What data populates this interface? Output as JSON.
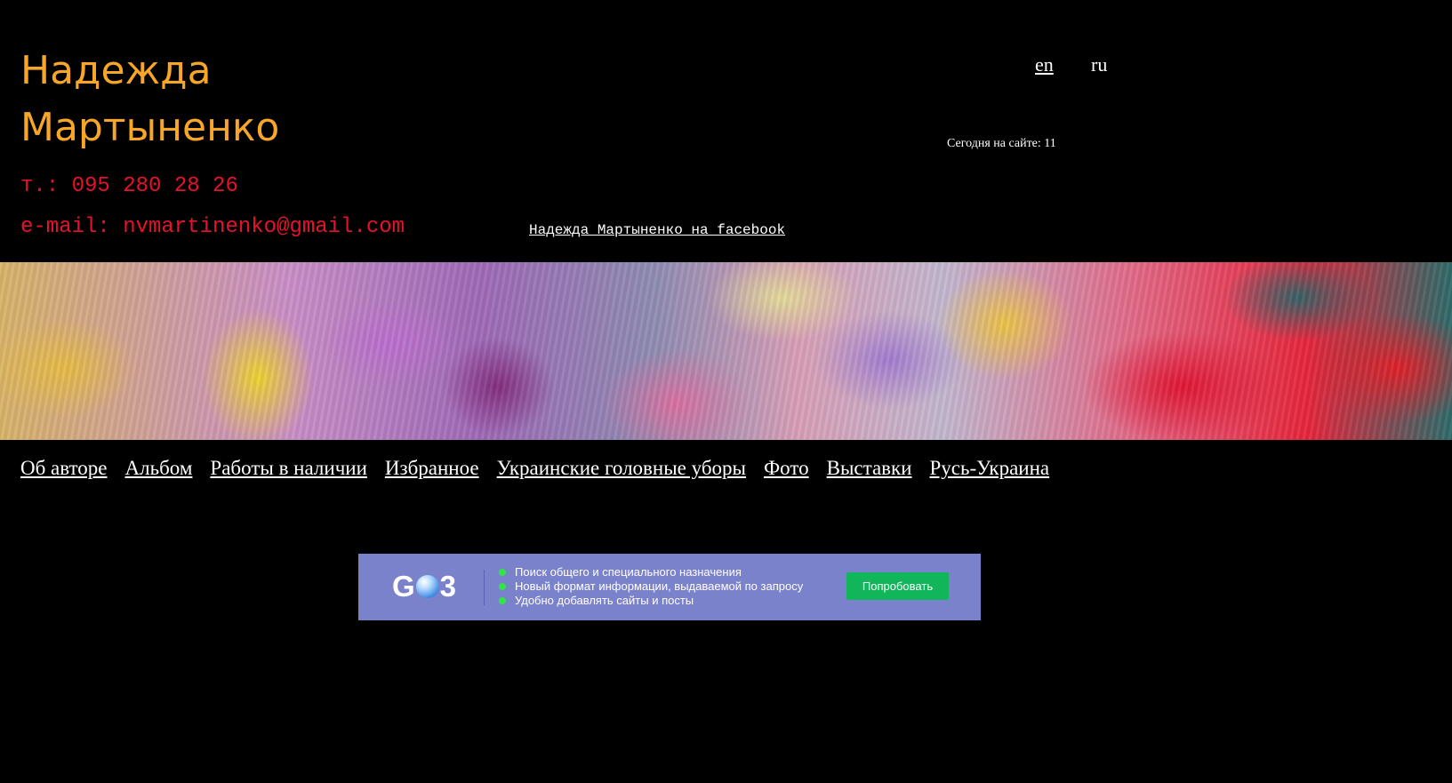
{
  "header": {
    "name_line1": "Надежда",
    "name_line2": "Мартыненко",
    "phone": "т.: 095 280 28 26",
    "email": "e-mail: nvmartinenko@gmail.com",
    "facebook_link": "Надежда Мартыненко на facebook",
    "lang_en": "en",
    "lang_ru": "ru",
    "visitors": "Сегодня на сайте: 11"
  },
  "nav": {
    "items": [
      {
        "label": "Об авторе"
      },
      {
        "label": "Альбом"
      },
      {
        "label": "Работы в наличии"
      },
      {
        "label": "Избранное"
      },
      {
        "label": "Украинские головные уборы"
      },
      {
        "label": "Фото"
      },
      {
        "label": "Выставки"
      },
      {
        "label": "Русь-Украина"
      }
    ]
  },
  "ad": {
    "logo_left": "G",
    "logo_right": "3",
    "features": [
      "Поиск общего и специального назначения",
      "Новый формат информации, выдаваемой по запросу",
      "Удобно добавлять сайты и посты"
    ],
    "button": "Попробовать"
  },
  "colors": {
    "background": "#000000",
    "name": "#f7a628",
    "contact": "#e8112b",
    "link": "#ffffff",
    "ad_background": "#7b82cc",
    "ad_button": "#11b55a"
  }
}
